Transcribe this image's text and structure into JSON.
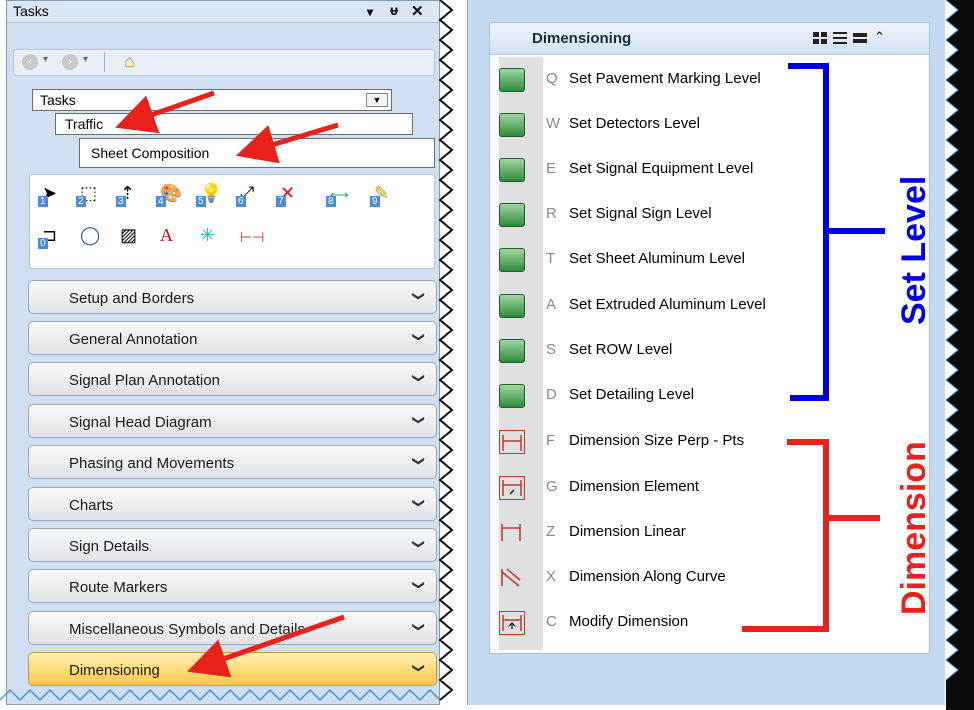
{
  "tasks_panel": {
    "title": "Tasks",
    "controls": {
      "dropdown": "▾",
      "pin": "ᵠ",
      "close": "✕"
    },
    "nav": {
      "back": "‹",
      "forward": "›"
    },
    "tabs": {
      "tasks": "Tasks",
      "traffic": "Traffic",
      "sheet_composition": "Sheet Composition"
    },
    "tool_numbers": [
      "1",
      "2",
      "3",
      "4",
      "5",
      "6",
      "7",
      "8",
      "9",
      "0"
    ],
    "sections": [
      "Setup and Borders",
      "General Annotation",
      "Signal Plan Annotation",
      "Signal Head Diagram",
      "Phasing and Movements",
      "Charts",
      "Sign Details",
      "Route Markers",
      "Miscellaneous Symbols and Details",
      "Dimensioning"
    ],
    "active_section": "Dimensioning"
  },
  "dimensioning_panel": {
    "title": "Dimensioning",
    "set_level_items": [
      {
        "key": "Q",
        "label": "Set Pavement Marking Level"
      },
      {
        "key": "W",
        "label": "Set Detectors Level"
      },
      {
        "key": "E",
        "label": "Set Signal Equipment Level"
      },
      {
        "key": "R",
        "label": "Set Signal Sign Level"
      },
      {
        "key": "T",
        "label": "Set Sheet Aluminum Level"
      },
      {
        "key": "A",
        "label": "Set Extruded Aluminum Level"
      },
      {
        "key": "S",
        "label": "Set ROW Level"
      },
      {
        "key": "D",
        "label": "Set Detailing Level"
      }
    ],
    "dimension_items": [
      {
        "key": "F",
        "label": "Dimension Size Perp - Pts"
      },
      {
        "key": "G",
        "label": "Dimension Element"
      },
      {
        "key": "Z",
        "label": "Dimension Linear"
      },
      {
        "key": "X",
        "label": "Dimension Along Curve"
      },
      {
        "key": "C",
        "label": "Modify Dimension"
      }
    ]
  },
  "annotations": {
    "set_level": "Set Level",
    "dimension": "Dimension",
    "set_level_color": "#0000e6",
    "dimension_color": "#e8211b"
  },
  "colors": {
    "panel_blue": "#cfe0f3",
    "active_section": "#ffc846",
    "arrow_red": "#e8211b"
  }
}
